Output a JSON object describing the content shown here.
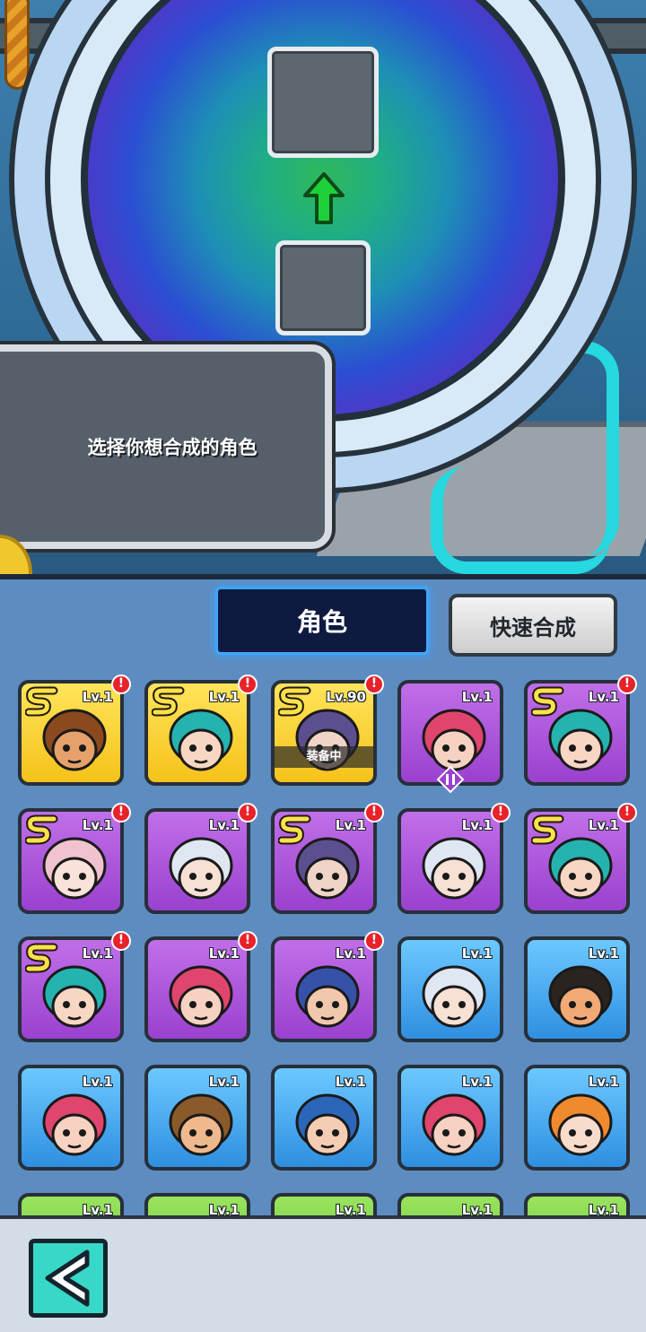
{
  "prompt": {
    "text": "选择你想合成的角色"
  },
  "tabs": {
    "roles_label": "角色"
  },
  "buttons": {
    "quick_merge_label": "快速合成"
  },
  "roster": {
    "cards": [
      {
        "rarity": "gold",
        "s_rank": true,
        "level": "Lv.1",
        "alert": true,
        "hero": "monkey"
      },
      {
        "rarity": "gold",
        "s_rank": true,
        "level": "Lv.1",
        "alert": true,
        "hero": "teal-hair-girl"
      },
      {
        "rarity": "gold",
        "s_rank": true,
        "level": "Lv.90",
        "alert": true,
        "hero": "horned-warrior",
        "equipped_label": "装备中"
      },
      {
        "rarity": "purple",
        "s_rank": false,
        "level": "Lv.1",
        "alert": false,
        "hero": "pink-hair-girl-goggles",
        "badge": "pause"
      },
      {
        "rarity": "purple",
        "s_rank": true,
        "level": "Lv.1",
        "alert": true,
        "hero": "teal-hair-girl"
      },
      {
        "rarity": "purple",
        "s_rank": true,
        "level": "Lv.1",
        "alert": true,
        "hero": "pink-white-hair-girl"
      },
      {
        "rarity": "purple",
        "s_rank": false,
        "level": "Lv.1",
        "alert": true,
        "hero": "silver-hair-headset"
      },
      {
        "rarity": "purple",
        "s_rank": true,
        "level": "Lv.1",
        "alert": true,
        "hero": "horned-warrior"
      },
      {
        "rarity": "purple",
        "s_rank": false,
        "level": "Lv.1",
        "alert": true,
        "hero": "silver-hair-headset"
      },
      {
        "rarity": "purple",
        "s_rank": true,
        "level": "Lv.1",
        "alert": true,
        "hero": "teal-hair-girl"
      },
      {
        "rarity": "purple",
        "s_rank": true,
        "level": "Lv.1",
        "alert": true,
        "hero": "teal-hair-girl"
      },
      {
        "rarity": "purple",
        "s_rank": false,
        "level": "Lv.1",
        "alert": true,
        "hero": "pink-hair-girl-goggles"
      },
      {
        "rarity": "purple",
        "s_rank": false,
        "level": "Lv.1",
        "alert": true,
        "hero": "blue-hair-man"
      },
      {
        "rarity": "blue",
        "s_rank": false,
        "level": "Lv.1",
        "alert": false,
        "hero": "silver-hair-headset"
      },
      {
        "rarity": "blue",
        "s_rank": false,
        "level": "Lv.1",
        "alert": false,
        "hero": "mustache-man-monocle"
      },
      {
        "rarity": "blue",
        "s_rank": false,
        "level": "Lv.1",
        "alert": false,
        "hero": "pink-hair-girl-goggles"
      },
      {
        "rarity": "blue",
        "s_rank": false,
        "level": "Lv.1",
        "alert": false,
        "hero": "cowboy"
      },
      {
        "rarity": "blue",
        "s_rank": false,
        "level": "Lv.1",
        "alert": false,
        "hero": "blue-hood-girl"
      },
      {
        "rarity": "blue",
        "s_rank": false,
        "level": "Lv.1",
        "alert": false,
        "hero": "pink-hair-girl-goggles"
      },
      {
        "rarity": "blue",
        "s_rank": false,
        "level": "Lv.1",
        "alert": false,
        "hero": "orange-bun-girl"
      },
      {
        "rarity": "green",
        "s_rank": false,
        "level": "Lv.1",
        "alert": false,
        "hero": "unknown"
      },
      {
        "rarity": "green",
        "s_rank": false,
        "level": "Lv.1",
        "alert": false,
        "hero": "unknown"
      },
      {
        "rarity": "green",
        "s_rank": false,
        "level": "Lv.1",
        "alert": false,
        "hero": "unknown"
      },
      {
        "rarity": "green",
        "s_rank": false,
        "level": "Lv.1",
        "alert": false,
        "hero": "unknown"
      },
      {
        "rarity": "green",
        "s_rank": false,
        "level": "Lv.1",
        "alert": false,
        "hero": "unknown"
      }
    ]
  },
  "colors": {
    "gold": "#f5c21a",
    "purple": "#9a41cf",
    "blue": "#2f8fe0",
    "green": "#54b82e",
    "accent": "#3ea6ff",
    "alert": "#e8222a",
    "back_button": "#38d8c8"
  },
  "icons": {
    "merge_arrow": "up-arrow-icon",
    "back": "back-arrow-icon",
    "alert": "exclamation-icon",
    "rank": "s-rank-icon",
    "pause": "pause-icon"
  }
}
